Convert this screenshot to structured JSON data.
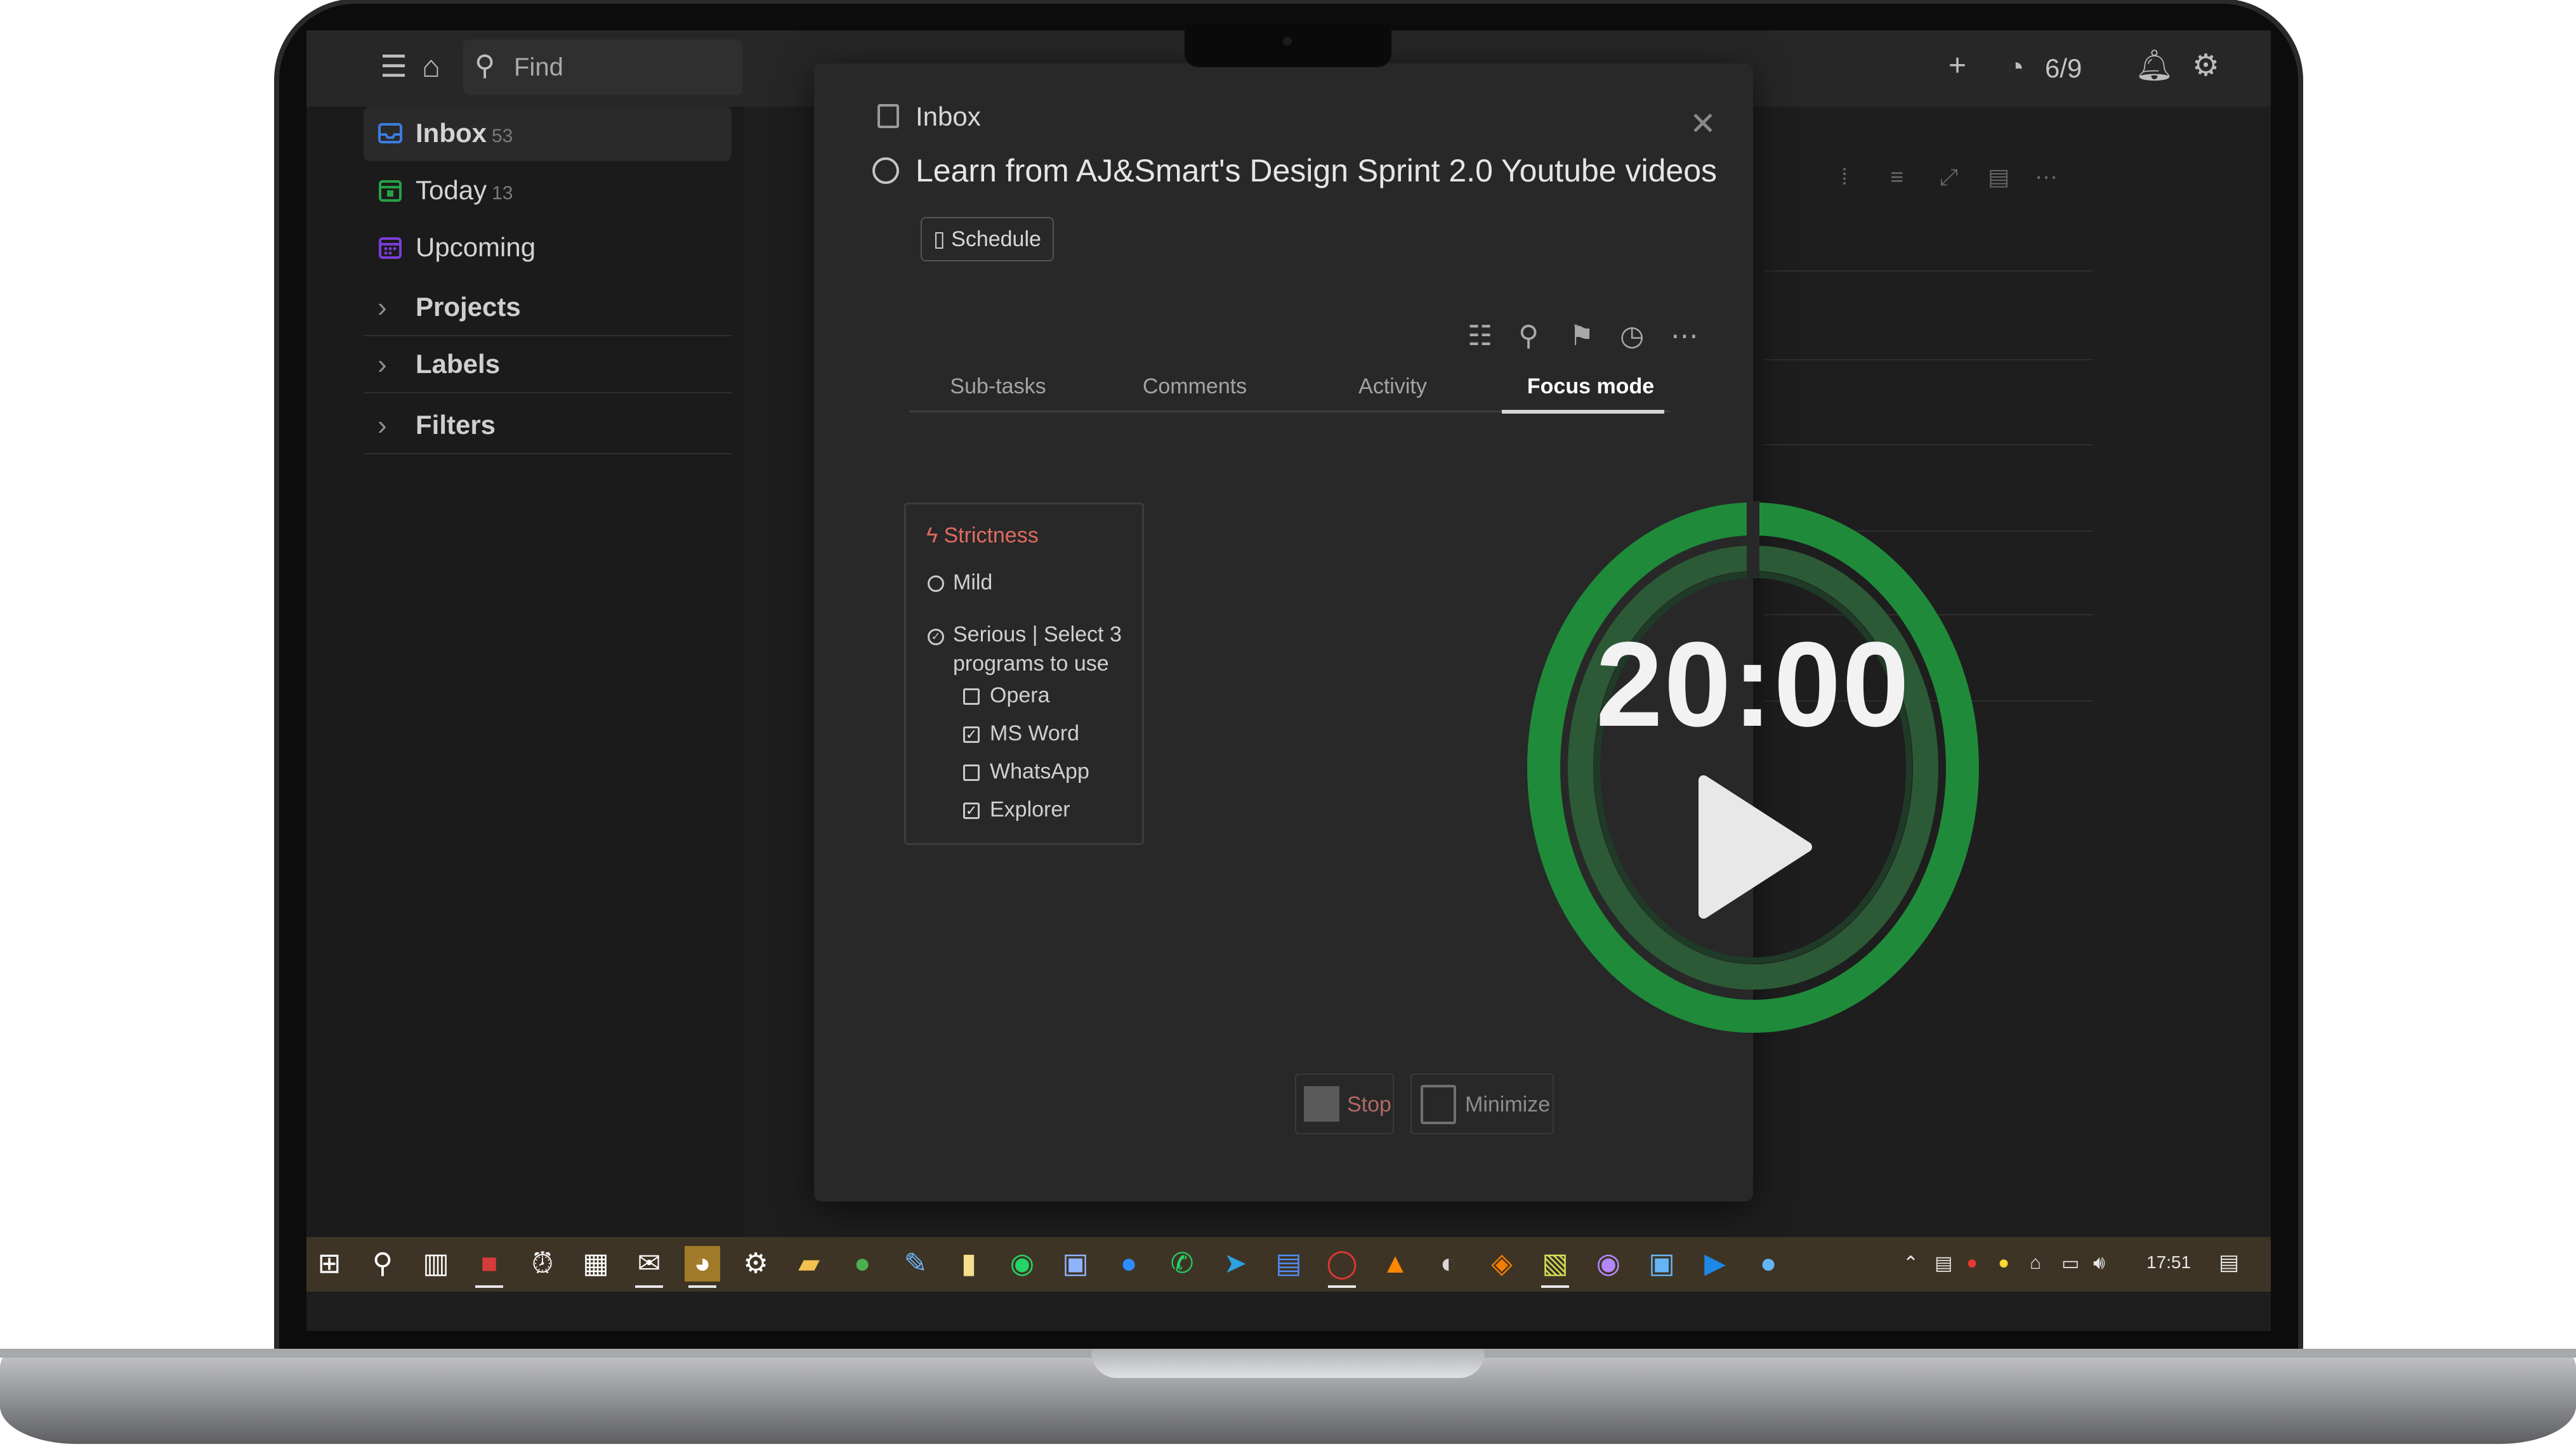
{
  "app": {
    "topbar": {
      "find_placeholder": "Find",
      "karma": "6/9",
      "icons": [
        "menu-icon",
        "home-icon",
        "search-icon",
        "plus-icon",
        "productivity-icon",
        "bell-icon",
        "gear-icon"
      ]
    },
    "sidebar": {
      "items": [
        {
          "label": "Inbox",
          "count": "53",
          "icon": "inbox-icon",
          "color": "#3b7de0"
        },
        {
          "label": "Today",
          "count": "13",
          "icon": "calendar-today-icon",
          "color": "#25a244"
        },
        {
          "label": "Upcoming",
          "count": "",
          "icon": "calendar-upcoming-icon",
          "color": "#7c3ed8"
        }
      ],
      "groups": [
        {
          "label": "Projects"
        },
        {
          "label": "Labels"
        },
        {
          "label": "Filters"
        }
      ]
    },
    "modal": {
      "breadcrumb": "Inbox",
      "task_title": "Learn from AJ&Smart's Design Sprint 2.0 Youtube videos",
      "schedule_label": "Schedule",
      "tabs": [
        {
          "label": "Sub-tasks",
          "active": false
        },
        {
          "label": "Comments",
          "active": false
        },
        {
          "label": "Activity",
          "active": false
        },
        {
          "label": "Focus mode",
          "active": true
        }
      ],
      "strictness": {
        "heading": "Strictness",
        "mild_label": "Mild",
        "serious_label_line1": "Serious | Select 3",
        "serious_label_line2": "programs to use",
        "selected": "serious",
        "programs": [
          {
            "label": "Opera",
            "checked": false
          },
          {
            "label": "MS Word",
            "checked": true
          },
          {
            "label": "WhatsApp",
            "checked": false
          },
          {
            "label": "Explorer",
            "checked": true
          }
        ]
      },
      "timer": {
        "time": "20:00",
        "ring_color": "#1f8b3a",
        "inner_ring_color": "#2c5a37"
      },
      "stop_label": "Stop",
      "minimize_label": "Minimize"
    },
    "taskbar": {
      "clock": "17:51"
    }
  }
}
